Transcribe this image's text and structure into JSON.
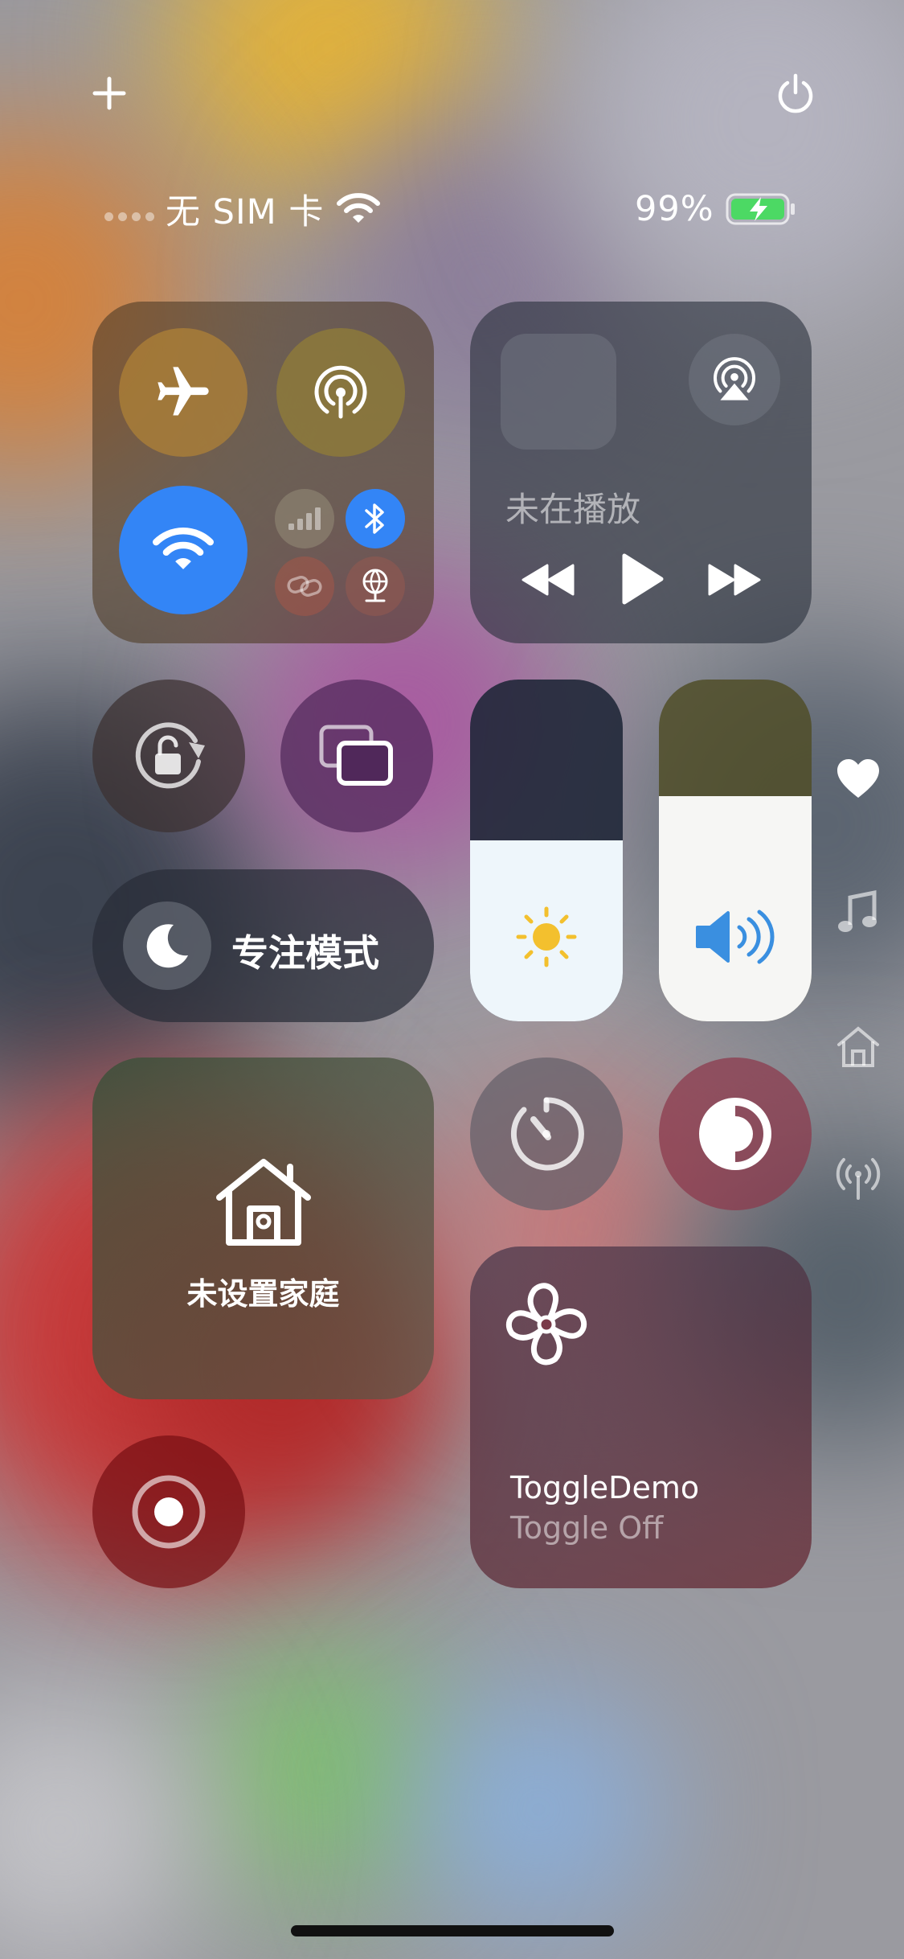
{
  "top": {
    "add_icon": "plus-icon",
    "power_icon": "power-icon"
  },
  "status": {
    "carrier": "无 SIM 卡",
    "battery_percent": "99%",
    "battery_level": 0.99,
    "battery_state": "charging",
    "wifi_icon": "wifi-icon"
  },
  "connectivity": {
    "airplane": {
      "icon": "airplane-icon",
      "on": false
    },
    "airdrop": {
      "icon": "airdrop-icon",
      "on": false
    },
    "wifi": {
      "icon": "wifi-icon",
      "on": true,
      "color": "#3385f6"
    },
    "cellular": {
      "icon": "cellular-bars-icon",
      "on": false
    },
    "bluetooth": {
      "icon": "bluetooth-icon",
      "on": true,
      "color": "#3385f6"
    },
    "personal_hotspot": {
      "icon": "link-icon",
      "on": false
    },
    "vpn": {
      "icon": "globe-network-icon",
      "on": false
    }
  },
  "music": {
    "status": "未在播放",
    "airplay_icon": "airplay-icon",
    "prev_icon": "rewind-icon",
    "play_icon": "play-icon",
    "next_icon": "fast-forward-icon"
  },
  "controls": {
    "rotation_lock_icon": "rotation-lock-icon",
    "screen_mirror_icon": "screen-mirroring-icon",
    "focus_label": "专注模式",
    "focus_icon": "moon-icon",
    "brightness_level": 0.53,
    "volume_level": 0.66,
    "brightness_icon": "sun-icon",
    "volume_icon": "speaker-icon",
    "home_label": "未设置家庭",
    "home_icon": "home-icon",
    "timer_icon": "timer-icon",
    "dark_mode_icon": "dark-mode-icon",
    "record_icon": "screen-record-icon"
  },
  "toggle_demo": {
    "title": "ToggleDemo",
    "subtitle": "Toggle Off",
    "icon": "fan-icon"
  },
  "side_pages": [
    "heart-icon",
    "music-note-icon",
    "home-icon",
    "antenna-icon"
  ]
}
